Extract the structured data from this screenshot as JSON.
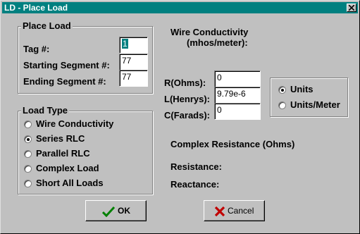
{
  "window": {
    "title": "LD - Place Load"
  },
  "place_load": {
    "title": "Place Load",
    "tag_label": "Tag #:",
    "tag_value": "1",
    "start_label": "Starting Segment #:",
    "start_value": "77",
    "end_label": "Ending Segment #:",
    "end_value": "77"
  },
  "load_type": {
    "title": "Load Type",
    "options": [
      {
        "label": "Wire Conductivity",
        "selected": false
      },
      {
        "label": "Series RLC",
        "selected": true
      },
      {
        "label": "Parallel RLC",
        "selected": false
      },
      {
        "label": "Complex Load",
        "selected": false
      },
      {
        "label": "Short All Loads",
        "selected": false
      }
    ]
  },
  "conductivity": {
    "heading_line1": "Wire Conductivity",
    "heading_line2": "(mhos/meter):"
  },
  "rlc": {
    "r_label": "R(Ohms):",
    "r_value": "0",
    "l_label": "L(Henrys):",
    "l_value": "9.79e-6",
    "c_label": "C(Farads):",
    "c_value": "0"
  },
  "units": {
    "options": [
      {
        "label": "Units",
        "selected": true
      },
      {
        "label": "Units/Meter",
        "selected": false
      }
    ]
  },
  "complex": {
    "heading": "Complex Resistance (Ohms)",
    "resistance_label": "Resistance:",
    "reactance_label": "Reactance:"
  },
  "buttons": {
    "ok_label": "OK",
    "cancel_label": "Cancel"
  },
  "colors": {
    "titlebar": "#008080",
    "face": "#c0c0c0",
    "ok_check": "#008000",
    "cancel_x": "#c00000"
  }
}
